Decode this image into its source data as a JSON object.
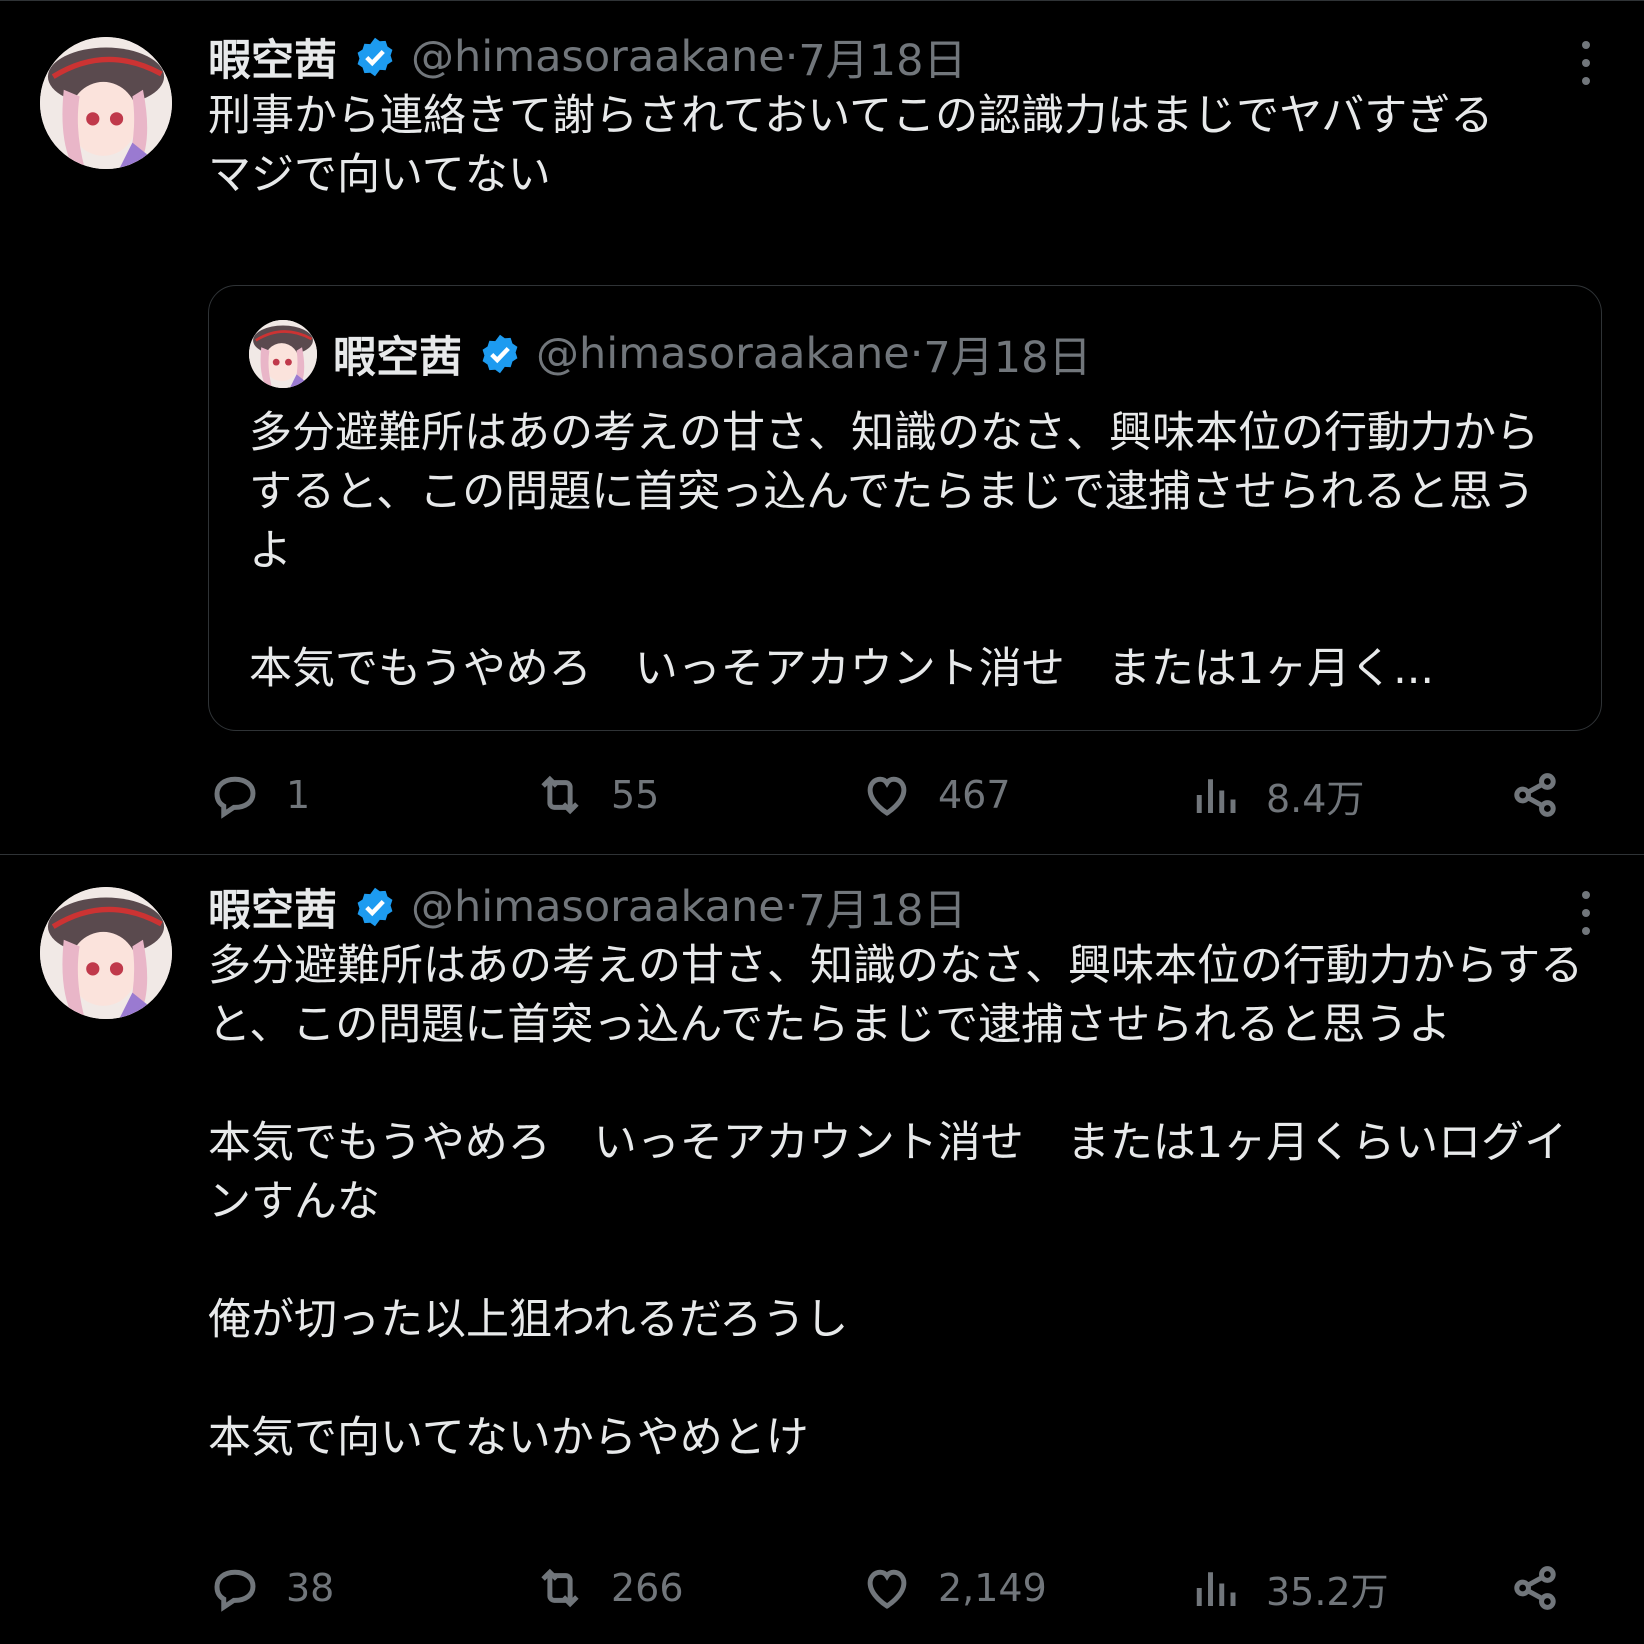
{
  "tweets": [
    {
      "display_name": "暇空茜",
      "handle": "@himasoraakane",
      "date": "7月18日",
      "text": "刑事から連絡きて謝らされておいてこの認識力はまじでヤバすぎる\nマジで向いてない",
      "quote": {
        "display_name": "暇空茜",
        "handle": "@himasoraakane",
        "date": "7月18日",
        "text": "多分避難所はあの考えの甘さ、知識のなさ、興味本位の行動力からすると、この問題に首突っ込んでたらまじで逮捕させられると思うよ\n\n本気でもうやめろ　いっそアカウント消せ　または1ヶ月く..."
      },
      "stats": {
        "replies": "1",
        "reposts": "55",
        "likes": "467",
        "views": "8.4万"
      }
    },
    {
      "display_name": "暇空茜",
      "handle": "@himasoraakane",
      "date": "7月18日",
      "text": "多分避難所はあの考えの甘さ、知識のなさ、興味本位の行動力からすると、この問題に首突っ込んでたらまじで逮捕させられると思うよ\n\n本気でもうやめろ　いっそアカウント消せ　または1ヶ月くらいログインすんな\n\n俺が切った以上狙われるだろうし\n\n本気で向いてないからやめとけ",
      "stats": {
        "replies": "38",
        "reposts": "266",
        "likes": "2,149",
        "views": "35.2万"
      }
    }
  ],
  "meta_separator": " · ",
  "colors": {
    "background": "#000000",
    "text": "#e7e9ea",
    "muted": "#71767b",
    "verified": "#1d9bf0",
    "border": "#2f3336"
  },
  "icons": [
    "reply-icon",
    "repost-icon",
    "like-icon",
    "views-icon",
    "share-icon",
    "verified-badge-icon",
    "more-icon"
  ]
}
